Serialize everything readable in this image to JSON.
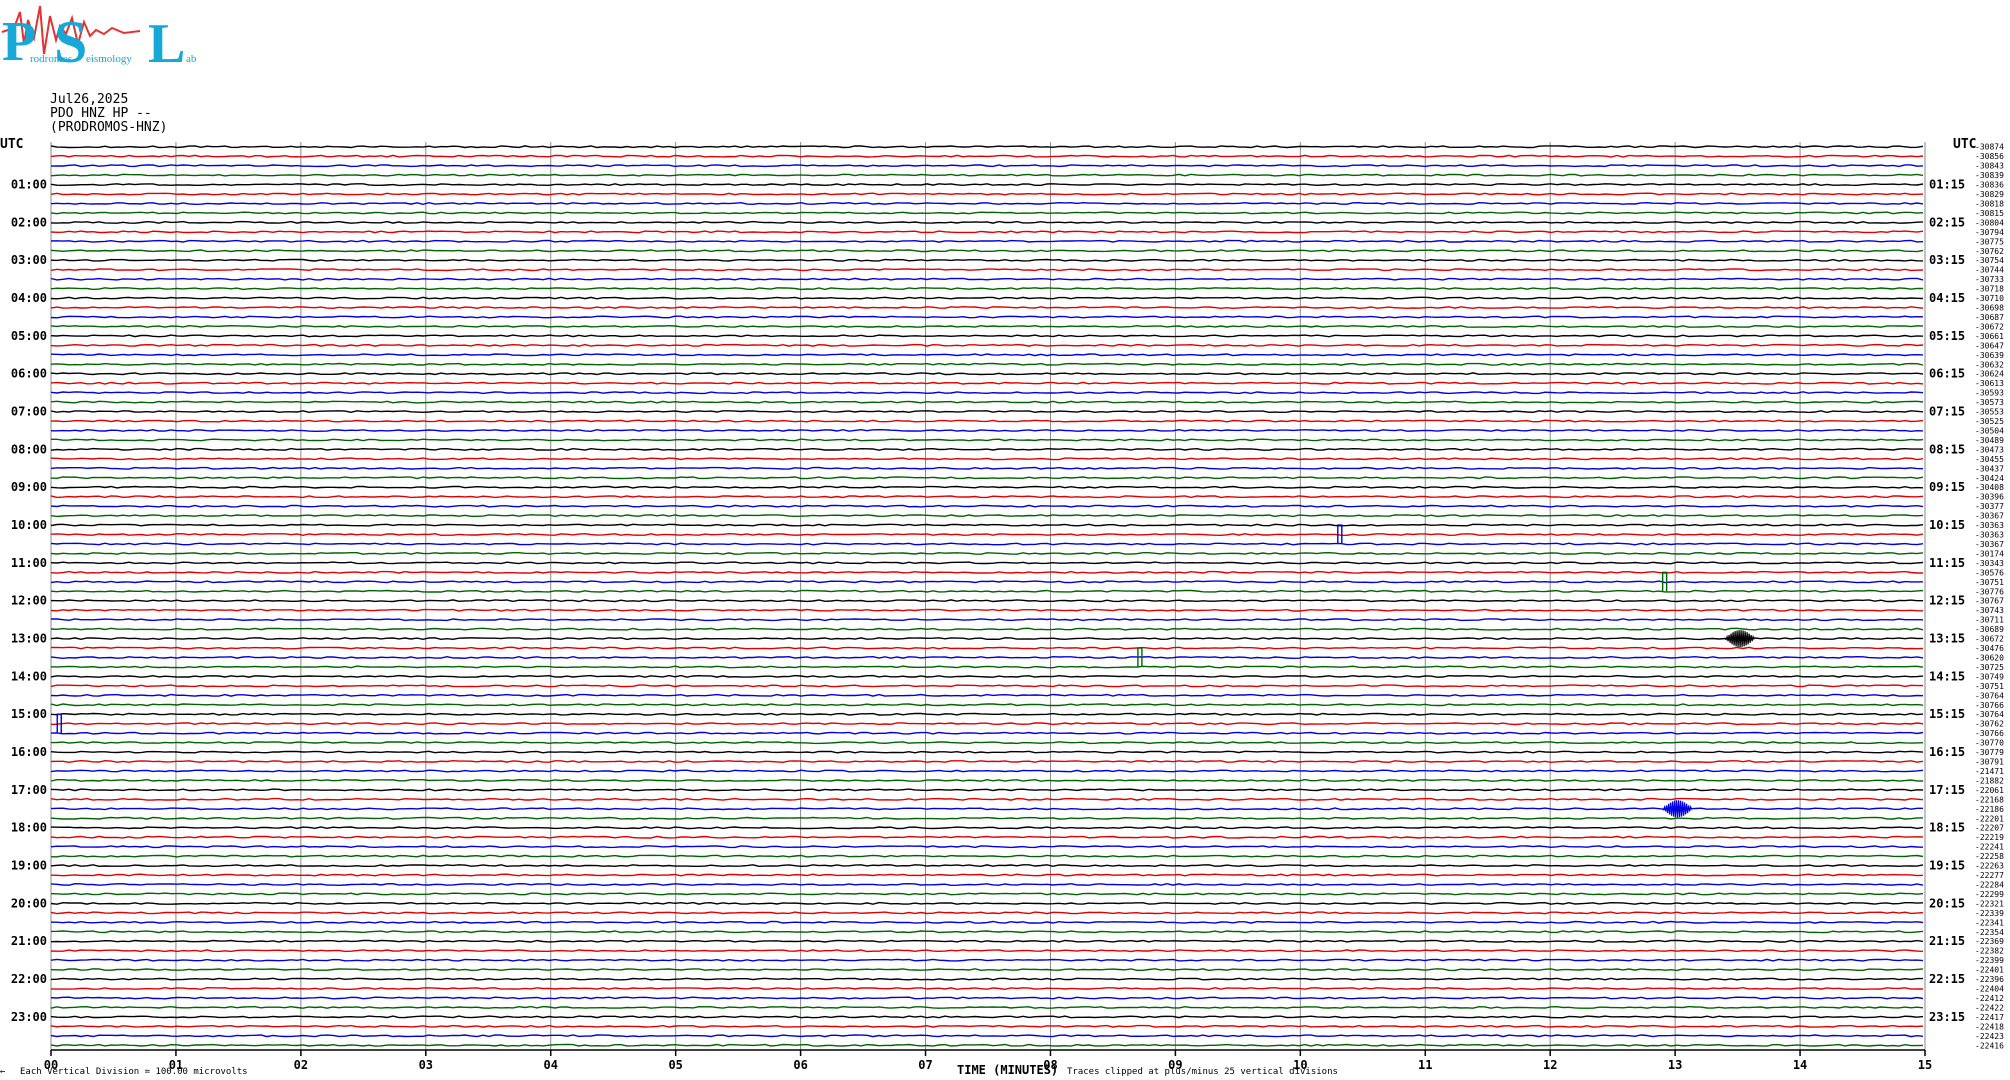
{
  "logo": {
    "big_letters": [
      "P",
      "S",
      "L"
    ],
    "words": [
      "rodromos",
      "eismology",
      "ab"
    ],
    "color": "#16a8d8",
    "wave_color": "#e23232"
  },
  "header": {
    "date": "Jul26,2025",
    "station": "PDO HNZ HP --",
    "site": "(PRODROMOS-HNZ)"
  },
  "footer": {
    "corner_mark": "←",
    "scale_note": "Each Vertical Division =  100.00 microvolts",
    "xlabel": "TIME (MINUTES)",
    "clip_note": "Traces clipped at plus/minus 25 vertical divisions"
  },
  "colors": {
    "cycle": [
      "#000000",
      "#e00000",
      "#0000e0",
      "#006400"
    ],
    "grid": "#8a8a8a"
  },
  "chart_data": {
    "type": "line",
    "title": "",
    "xlabel": "TIME (MINUTES)",
    "ylabel_left": "UTC",
    "ylabel_right": "UTC",
    "xlim": [
      0,
      15
    ],
    "x_ticks": [
      "00",
      "01",
      "02",
      "03",
      "04",
      "05",
      "06",
      "07",
      "08",
      "09",
      "10",
      "11",
      "12",
      "13",
      "14",
      "15"
    ],
    "rows": 96,
    "minutes_per_row": 15,
    "left_labels": [
      "01:00",
      "02:00",
      "03:00",
      "04:00",
      "05:00",
      "06:00",
      "07:00",
      "08:00",
      "09:00",
      "10:00",
      "11:00",
      "12:00",
      "13:00",
      "14:00",
      "15:00",
      "16:00",
      "17:00",
      "18:00",
      "19:00",
      "20:00",
      "21:00",
      "22:00",
      "23:00"
    ],
    "right_labels": [
      "01:15",
      "02:15",
      "03:15",
      "04:15",
      "05:15",
      "06:15",
      "07:15",
      "08:15",
      "09:15",
      "10:15",
      "11:15",
      "12:15",
      "13:15",
      "14:15",
      "15:15",
      "16:15",
      "17:15",
      "18:15",
      "19:15",
      "20:15",
      "21:15",
      "22:15",
      "23:15"
    ],
    "row_offsets": [
      "-30874",
      "-30856",
      "-30843",
      "-30839",
      "-30836",
      "-30829",
      "-30818",
      "-30815",
      "-30804",
      "-30794",
      "-30775",
      "-30762",
      "-30754",
      "-30744",
      "-30733",
      "-30718",
      "-30710",
      "-30698",
      "-30687",
      "-30672",
      "-30661",
      "-30647",
      "-30639",
      "-30632",
      "-30624",
      "-30613",
      "-30593",
      "-30573",
      "-30553",
      "-30525",
      "-30504",
      "-30489",
      "-30473",
      "-30455",
      "-30437",
      "-30424",
      "-30408",
      "-30396",
      "-30377",
      "-30367",
      "-30363",
      "-30363",
      "-30367",
      "-30174",
      "-30343",
      "-30576",
      "-30751",
      "-30776",
      "-30767",
      "-30743",
      "-30711",
      "-30689",
      "-30672",
      "-30476",
      "-30620",
      "-30725",
      "-30749",
      "-30751",
      "-30764",
      "-30766",
      "-30764",
      "-30762",
      "-30766",
      "-30770",
      "-30779",
      "-30791",
      "-21471",
      "-21882",
      "-22061",
      "-22168",
      "-22186",
      "-22201",
      "-22207",
      "-22219",
      "-22241",
      "-22258",
      "-22263",
      "-22277",
      "-22284",
      "-22299",
      "-22321",
      "-22339",
      "-22341",
      "-22354",
      "-22369",
      "-22382",
      "-22399",
      "-22401",
      "-22396",
      "-22404",
      "-22412",
      "-22422",
      "-22417",
      "-22418",
      "-22423",
      "-22416"
    ],
    "events": [
      {
        "row": 42,
        "minute": 10.3,
        "kind": "step"
      },
      {
        "row": 47,
        "minute": 12.9,
        "kind": "step"
      },
      {
        "row": 52,
        "minute": 13.4,
        "kind": "burst"
      },
      {
        "row": 55,
        "minute": 8.7,
        "kind": "step"
      },
      {
        "row": 62,
        "minute": 0.05,
        "kind": "step"
      },
      {
        "row": 70,
        "minute": 12.9,
        "kind": "burst"
      }
    ]
  }
}
